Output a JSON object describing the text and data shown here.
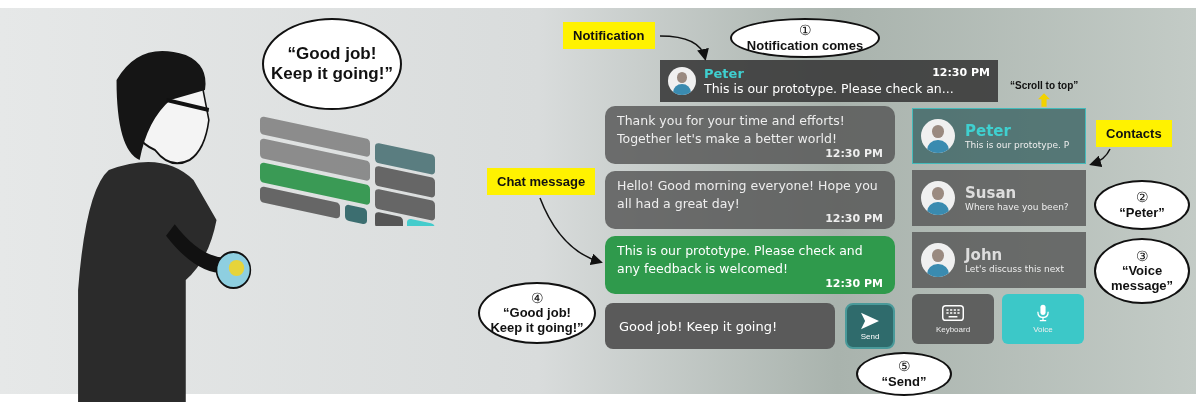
{
  "scene_bubble": {
    "text": "“Good job!\nKeep it going!”"
  },
  "labels": [
    {
      "text": "Notification"
    },
    {
      "text": "Chat message"
    },
    {
      "text": "Contacts"
    }
  ],
  "scroll_hint": {
    "text": "“Scroll to top”"
  },
  "notification": {
    "name": "Peter",
    "time": "12:30 PM",
    "text": "This is our prototype. Please check an..."
  },
  "messages": [
    {
      "kind": "received",
      "text": "Thank you for your time and efforts! Together let's make a better world!",
      "time": "12:30 PM"
    },
    {
      "kind": "received",
      "text": "Hello! Good morning everyone! Hope you all had a great day!",
      "time": "12:30 PM"
    },
    {
      "kind": "sent",
      "text": "This is our prototype. Please check and any feedback is welcomed!",
      "time": "12:30 PM"
    }
  ],
  "input": {
    "value": "Good job! Keep it going!"
  },
  "send_button": {
    "label": "Send"
  },
  "contacts": [
    {
      "name": "Peter",
      "preview": "This is our prototype. P",
      "selected": true
    },
    {
      "name": "Susan",
      "preview": "Where have you been?",
      "selected": false
    },
    {
      "name": "John",
      "preview": "Let's discuss this next",
      "selected": false
    }
  ],
  "mode_buttons": [
    {
      "kind": "keyboard",
      "label": "Keyboard",
      "on": false
    },
    {
      "kind": "voice",
      "label": "Voice",
      "on": true
    }
  ],
  "callouts": [
    {
      "number": "①",
      "text": "Notification comes"
    },
    {
      "number": "②",
      "text": "“Peter”"
    },
    {
      "number": "③",
      "text": "“Voice\nmessage”"
    },
    {
      "number": "④",
      "text": "“Good job!\nKeep it going!”"
    },
    {
      "number": "⑤",
      "text": "“Send”"
    }
  ]
}
